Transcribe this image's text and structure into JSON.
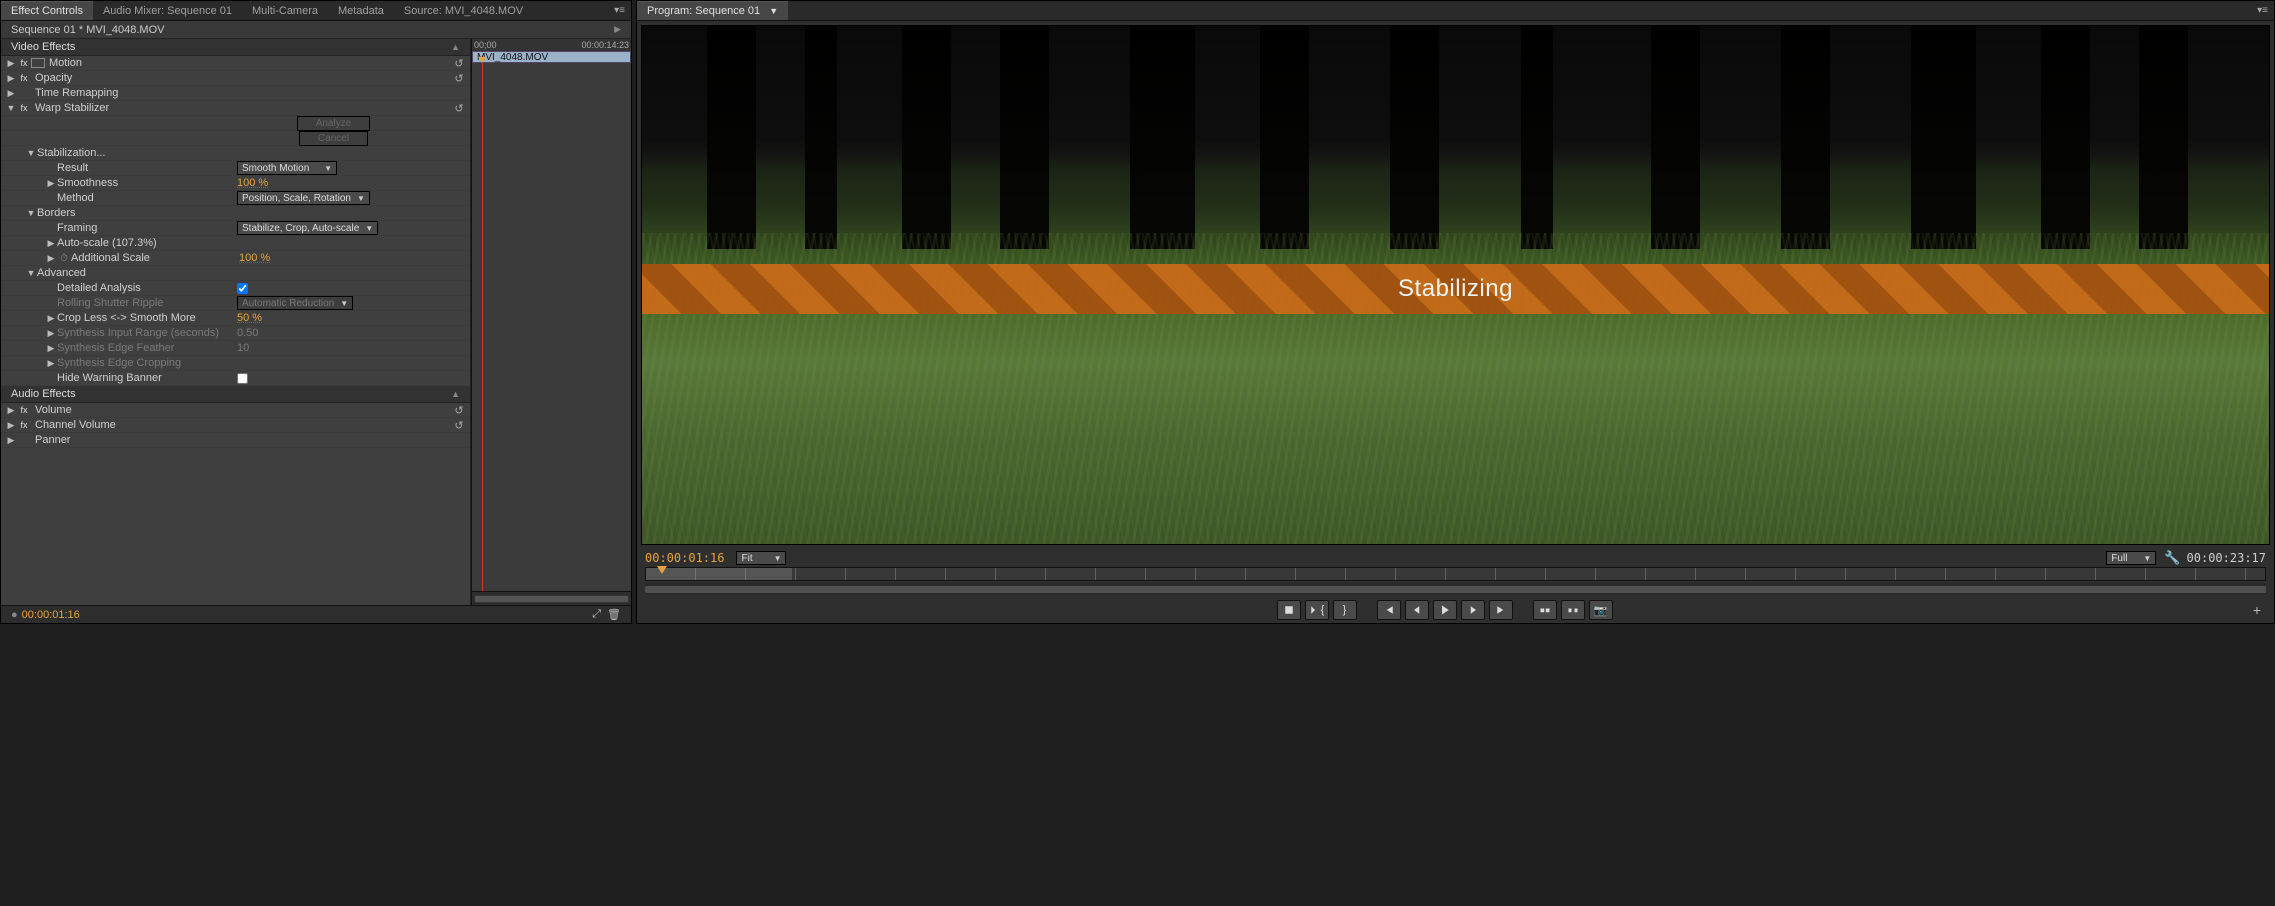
{
  "left": {
    "tabs": [
      "Effect Controls",
      "Audio Mixer: Sequence 01",
      "Multi-Camera",
      "Metadata",
      "Source: MVI_4048.MOV"
    ],
    "active_tab": 0,
    "clip_path": "Sequence 01 * MVI_4048.MOV",
    "sections": {
      "video": "Video Effects",
      "audio": "Audio Effects"
    },
    "video_effects": {
      "motion": "Motion",
      "opacity": "Opacity",
      "time_remapping": "Time Remapping",
      "warp": {
        "name": "Warp Stabilizer",
        "analyze": "Analyze",
        "cancel": "Cancel",
        "stabilization": "Stabilization...",
        "result_label": "Result",
        "result_value": "Smooth Motion",
        "smoothness_label": "Smoothness",
        "smoothness_value": "100 %",
        "method_label": "Method",
        "method_value": "Position, Scale, Rotation",
        "borders": "Borders",
        "framing_label": "Framing",
        "framing_value": "Stabilize, Crop, Auto-scale",
        "autoscale_label": "Auto-scale (107.3%)",
        "additional_scale_label": "Additional Scale",
        "additional_scale_value": "100 %",
        "advanced": "Advanced",
        "detailed_analysis_label": "Detailed Analysis",
        "detailed_analysis_checked": true,
        "rolling_shutter_label": "Rolling Shutter Ripple",
        "rolling_shutter_value": "Automatic Reduction",
        "crop_less_label": "Crop Less <-> Smooth More",
        "crop_less_value": "50 %",
        "synth_range_label": "Synthesis Input Range (seconds)",
        "synth_range_value": "0.50",
        "synth_feather_label": "Synthesis Edge Feather",
        "synth_feather_value": "10",
        "synth_crop_label": "Synthesis Edge Cropping",
        "hide_banner_label": "Hide Warning Banner",
        "hide_banner_checked": false
      }
    },
    "audio_effects": {
      "volume": "Volume",
      "channel_volume": "Channel Volume",
      "panner": "Panner"
    },
    "timeline_hdr_left": "00;00",
    "timeline_hdr_right": "00:00:14:23",
    "timeline_clip": "MVI_4048.MOV",
    "footer_tc": "00:00:01:16"
  },
  "right": {
    "tab": "Program: Sequence 01",
    "banner": "Stabilizing",
    "tc_left": "00:00:01:16",
    "fit": "Fit",
    "resolution": "Full",
    "tc_right": "00:00:23:17"
  },
  "icons": {
    "reset": "↺",
    "wrench": "🔧",
    "camera": "📷"
  }
}
